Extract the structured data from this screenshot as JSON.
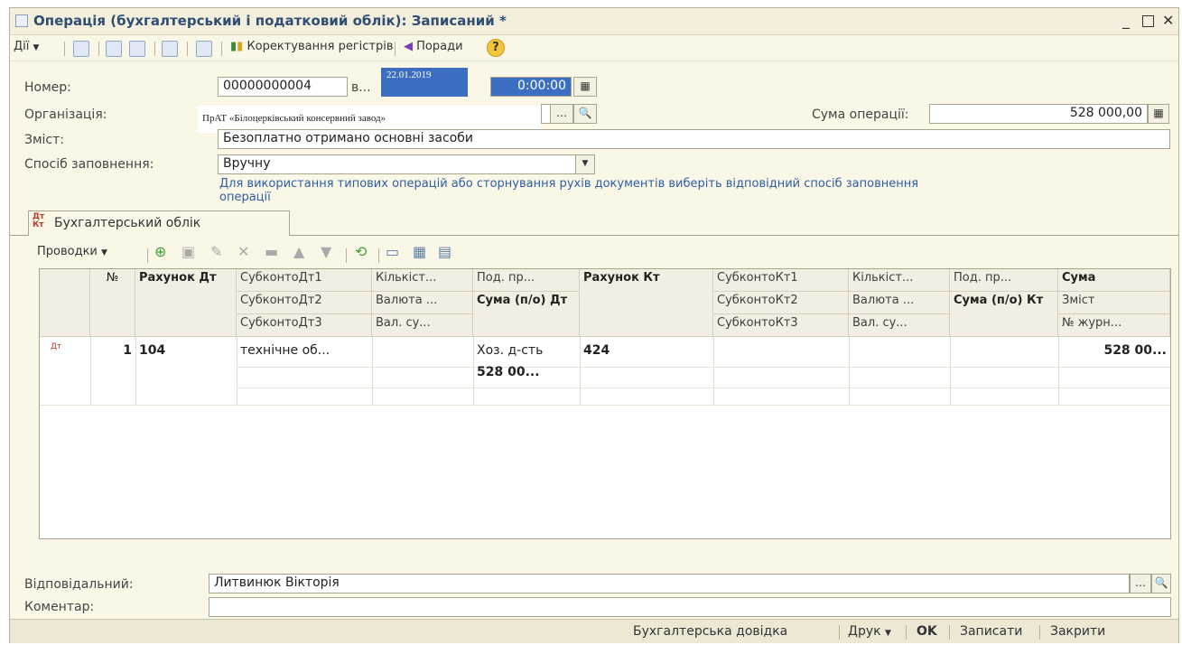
{
  "window": {
    "title": "Операція (бухгалтерський і податковий облік): Записаний *"
  },
  "toolbar": {
    "actions_label": "Дії",
    "register_correction_label": "Коректування регістрів",
    "tips_label": "Поради",
    "help_label": "?"
  },
  "form": {
    "number_label": "Номер:",
    "number_value": "00000000004",
    "from_label": "в...",
    "date_value": "22.01.2019",
    "time_value": "0:00:00",
    "org_label": "Організація:",
    "org_value": "ПрАТ «Білоцерківський консервний завод»",
    "sum_label": "Сума операції:",
    "sum_value": "528 000,00",
    "content_label": "Зміст:",
    "content_value": "Безоплатно отримано основні засоби",
    "fill_method_label": "Спосіб заповнення:",
    "fill_method_value": "Вручну",
    "fill_hint": "Для використання типових операцій або сторнування рухів документів виберіть відповідний спосіб заповнення операції",
    "responsible_label": "Відповідальний:",
    "responsible_value": "Литвинюк Вікторія",
    "comment_label": "Коментар:",
    "comment_value": ""
  },
  "tab": {
    "icon_text": "Дт Кт",
    "label": "Бухгалтерський облік"
  },
  "grid_toolbar": {
    "entries_label": "Проводки"
  },
  "grid": {
    "headers": {
      "num": "№",
      "acc_dt": "Рахунок Дт",
      "sub_dt1": "СубконтоДт1",
      "sub_dt2": "СубконтоДт2",
      "sub_dt3": "СубконтоДт3",
      "qty_dt": "Кількіст...",
      "cur_dt": "Валюта ...",
      "cur_sum_dt": "Вал. су...",
      "tax_dt": "Под. пр...",
      "sum_tax_dt": "Сума (п/о) Дт",
      "acc_kt": "Рахунок Кт",
      "sub_kt1": "СубконтоКт1",
      "sub_kt2": "СубконтоКт2",
      "sub_kt3": "СубконтоКт3",
      "qty_kt": "Кількіст...",
      "cur_kt": "Валюта ...",
      "cur_sum_kt": "Вал. су...",
      "tax_kt": "Под. пр...",
      "sum_tax_kt": "Сума (п/о) Кт",
      "sum": "Сума",
      "content": "Зміст",
      "journal": "№ журн..."
    },
    "rows": [
      {
        "icon": "Дт Кт",
        "num": "1",
        "acc_dt": "104",
        "sub_dt1": "технічне об...",
        "tax_dt": "Хоз. д-сть",
        "sum_tax_dt": "528 00...",
        "acc_kt": "424",
        "sum": "528 00..."
      }
    ]
  },
  "statusbar": {
    "accounting_ref": "Бухгалтерська довідка",
    "print": "Друк",
    "ok": "OK",
    "save": "Записати",
    "close": "Закрити"
  }
}
